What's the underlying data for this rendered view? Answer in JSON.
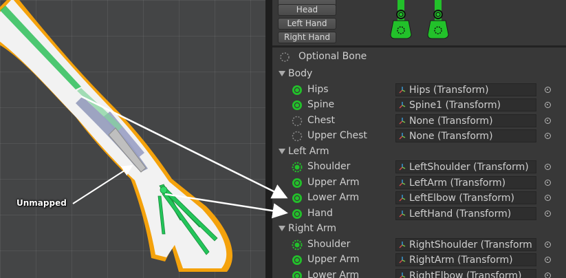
{
  "scene": {
    "annotation": "Unmapped"
  },
  "body_parts": [
    "Head",
    "Left Hand",
    "Right Hand"
  ],
  "optional_bone_label": "Optional Bone",
  "sections": [
    {
      "title": "Body",
      "bones": [
        {
          "name": "Hips",
          "value": "Hips (Transform)",
          "state": "mapped"
        },
        {
          "name": "Spine",
          "value": "Spine1 (Transform)",
          "state": "mapped"
        },
        {
          "name": "Chest",
          "value": "None (Transform)",
          "state": "optional-empty"
        },
        {
          "name": "Upper Chest",
          "value": "None (Transform)",
          "state": "optional-empty"
        }
      ]
    },
    {
      "title": "Left Arm",
      "bones": [
        {
          "name": "Shoulder",
          "value": "LeftShoulder (Transform)",
          "state": "optional-mapped"
        },
        {
          "name": "Upper Arm",
          "value": "LeftArm (Transform)",
          "state": "mapped"
        },
        {
          "name": "Lower Arm",
          "value": "LeftElbow (Transform)",
          "state": "mapped"
        },
        {
          "name": "Hand",
          "value": "LeftHand (Transform)",
          "state": "mapped"
        }
      ]
    },
    {
      "title": "Right Arm",
      "bones": [
        {
          "name": "Shoulder",
          "value": "RightShoulder (Transform",
          "state": "optional-mapped"
        },
        {
          "name": "Upper Arm",
          "value": "RightArm (Transform)",
          "state": "mapped"
        },
        {
          "name": "Lower Arm",
          "value": "RightElbow (Transform)",
          "state": "mapped"
        }
      ]
    }
  ],
  "colors": {
    "mapped_green": "#22c12a",
    "arm_outline": "#f4a20c",
    "annotation_arrow": "#ffffff"
  }
}
